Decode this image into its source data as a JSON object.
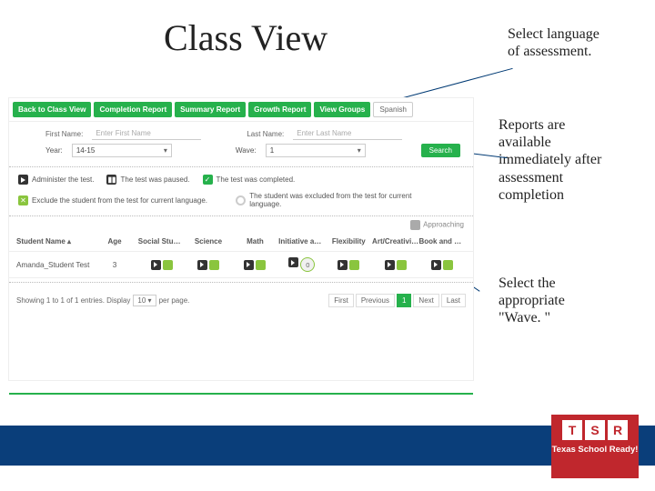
{
  "title": "Class View",
  "annotations": {
    "a1": "Select language of assessment.",
    "a2": "Reports are available immediately after assessment completion",
    "a3": "Select the appropriate \"Wave. \""
  },
  "toolbar": {
    "back": "Back to Class View",
    "completion": "Completion Report",
    "summary": "Summary Report",
    "growth": "Growth Report",
    "groups": "View Groups",
    "language": "Spanish"
  },
  "search": {
    "first_label": "First Name:",
    "first_placeholder": "Enter First Name",
    "last_label": "Last Name:",
    "last_placeholder": "Enter Last Name",
    "year_label": "Year:",
    "year_value": "14-15",
    "wave_label": "Wave:",
    "wave_value": "1",
    "search_btn": "Search"
  },
  "legend": {
    "l1": "Administer the test.",
    "l2": "The test was paused.",
    "l3": "The test was completed.",
    "l4": "Exclude the student from the test for current language.",
    "l5": "The student was excluded from the test for current language.",
    "approaching": "Approaching"
  },
  "table": {
    "headers": {
      "student": "Student Name",
      "age": "Age",
      "social": "Social Studies",
      "science": "Science",
      "math": "Math",
      "init": "Initiative and Curio...",
      "flex": "Flexibility",
      "art": "Art/Creativity And D...",
      "book": "Book and Print R..."
    },
    "row": {
      "name": "Amanda_Student Test",
      "age": "3",
      "init_badge": "0"
    }
  },
  "footer": {
    "showing": "Showing 1 to 1 of 1 entries. Display",
    "per_page_value": "10",
    "per_page_suffix": "per page.",
    "first": "First",
    "prev": "Previous",
    "current": "1",
    "next": "Next",
    "last": "Last"
  },
  "logo": {
    "t": "T",
    "s": "S",
    "r": "R",
    "sub": "Texas School Ready!"
  }
}
